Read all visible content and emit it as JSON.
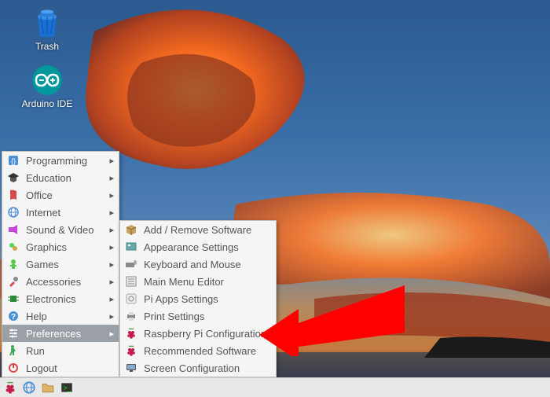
{
  "desktop": {
    "icons": [
      {
        "label": "Trash",
        "name": "trash-icon"
      },
      {
        "label": "Arduino IDE",
        "name": "arduino-icon"
      }
    ]
  },
  "menu": {
    "items": [
      {
        "label": "Programming",
        "icon": "programming-icon",
        "arrow": true
      },
      {
        "label": "Education",
        "icon": "education-icon",
        "arrow": true
      },
      {
        "label": "Office",
        "icon": "office-icon",
        "arrow": true
      },
      {
        "label": "Internet",
        "icon": "internet-icon",
        "arrow": true
      },
      {
        "label": "Sound & Video",
        "icon": "sound-video-icon",
        "arrow": true
      },
      {
        "label": "Graphics",
        "icon": "graphics-icon",
        "arrow": true
      },
      {
        "label": "Games",
        "icon": "games-icon",
        "arrow": true
      },
      {
        "label": "Accessories",
        "icon": "accessories-icon",
        "arrow": true
      },
      {
        "label": "Electronics",
        "icon": "electronics-icon",
        "arrow": true
      },
      {
        "label": "Help",
        "icon": "help-icon",
        "arrow": true
      },
      {
        "label": "Preferences",
        "icon": "preferences-icon",
        "arrow": true,
        "selected": true
      },
      {
        "label": "Run",
        "icon": "run-icon",
        "arrow": false
      },
      {
        "label": "Logout",
        "icon": "logout-icon",
        "arrow": false
      }
    ]
  },
  "submenu": {
    "items": [
      {
        "label": "Add / Remove Software",
        "icon": "package-icon"
      },
      {
        "label": "Appearance Settings",
        "icon": "appearance-icon"
      },
      {
        "label": "Keyboard and Mouse",
        "icon": "keyboard-mouse-icon"
      },
      {
        "label": "Main Menu Editor",
        "icon": "menu-editor-icon"
      },
      {
        "label": "Pi Apps Settings",
        "icon": "pi-apps-icon"
      },
      {
        "label": "Print Settings",
        "icon": "print-icon"
      },
      {
        "label": "Raspberry Pi Configuration",
        "icon": "raspberry-icon"
      },
      {
        "label": "Recommended Software",
        "icon": "raspberry-icon"
      },
      {
        "label": "Screen Configuration",
        "icon": "screen-icon"
      }
    ]
  },
  "taskbar": {
    "items": [
      {
        "name": "start-menu-icon"
      },
      {
        "name": "web-browser-icon"
      },
      {
        "name": "file-manager-icon"
      },
      {
        "name": "terminal-icon"
      }
    ]
  },
  "colors": {
    "raspberry": "#c51a4a",
    "arrow": "#ff0000"
  }
}
